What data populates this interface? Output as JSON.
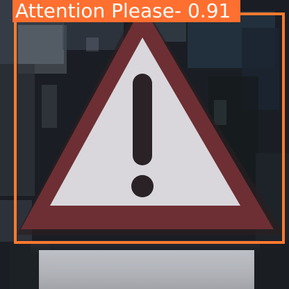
{
  "detection": {
    "label": "Attention Please- 0.91",
    "box_color": "#ff7a2f"
  }
}
